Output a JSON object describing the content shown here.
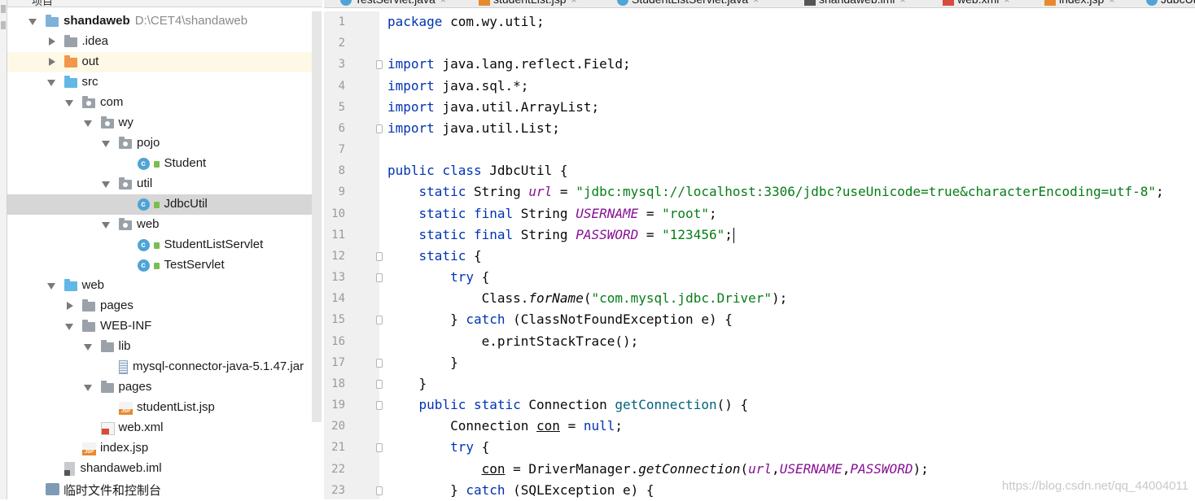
{
  "project_panel": {
    "header_label": "项目",
    "tree": [
      {
        "label": "shandaweb",
        "path": "D:\\CET4\\shandaweb",
        "icon": "project-folder-icon",
        "expanded": true
      },
      {
        "label": ".idea",
        "icon": "folder-icon",
        "expanded": false
      },
      {
        "label": "out",
        "icon": "excluded-folder-icon",
        "expanded": false
      },
      {
        "label": "src",
        "icon": "source-folder-icon",
        "expanded": true
      },
      {
        "label": "com",
        "icon": "package-icon",
        "expanded": true
      },
      {
        "label": "wy",
        "icon": "package-icon",
        "expanded": true
      },
      {
        "label": "pojo",
        "icon": "package-icon",
        "expanded": true
      },
      {
        "label": "Student",
        "icon": "class-icon"
      },
      {
        "label": "util",
        "icon": "package-icon",
        "expanded": true
      },
      {
        "label": "JdbcUtil",
        "icon": "class-icon",
        "selected": true
      },
      {
        "label": "web",
        "icon": "package-icon",
        "expanded": true
      },
      {
        "label": "StudentListServlet",
        "icon": "class-icon"
      },
      {
        "label": "TestServlet",
        "icon": "class-icon"
      },
      {
        "label": "web",
        "icon": "web-folder-icon",
        "expanded": true
      },
      {
        "label": "pages",
        "icon": "folder-icon",
        "expanded": false
      },
      {
        "label": "WEB-INF",
        "icon": "folder-icon",
        "expanded": true
      },
      {
        "label": "lib",
        "icon": "folder-icon",
        "expanded": true
      },
      {
        "label": "mysql-connector-java-5.1.47.jar",
        "icon": "jar-file-icon"
      },
      {
        "label": "pages",
        "icon": "folder-icon",
        "expanded": true
      },
      {
        "label": "studentList.jsp",
        "icon": "jsp-file-icon"
      },
      {
        "label": "web.xml",
        "icon": "xml-file-icon"
      },
      {
        "label": "index.jsp",
        "icon": "jsp-file-icon"
      },
      {
        "label": "shandaweb.iml",
        "icon": "iml-file-icon"
      },
      {
        "label": "临时文件和控制台",
        "icon": "scratches-icon"
      }
    ]
  },
  "tabs": [
    {
      "label": "TestServlet.java",
      "icon": "class-icon"
    },
    {
      "label": "studentList.jsp",
      "icon": "jsp-file-icon"
    },
    {
      "label": "StudentListServlet.java",
      "icon": "class-icon"
    },
    {
      "label": "shandaweb.iml",
      "icon": "iml-file-icon"
    },
    {
      "label": "web.xml",
      "icon": "xml-file-icon"
    },
    {
      "label": "index.jsp",
      "icon": "jsp-file-icon"
    },
    {
      "label": "JdbcUtil.java",
      "icon": "class-icon",
      "active": true
    }
  ],
  "editor": {
    "current_line": 11,
    "lines": [
      {
        "n": "1",
        "t": [
          {
            "k": "kw",
            "s": "package"
          },
          {
            "k": "",
            "s": " com.wy.util;"
          }
        ]
      },
      {
        "n": "2",
        "t": []
      },
      {
        "n": "3",
        "t": [
          {
            "k": "kw",
            "s": "import"
          },
          {
            "k": "",
            "s": " java.lang.reflect.Field;"
          }
        ]
      },
      {
        "n": "4",
        "t": [
          {
            "k": "kw",
            "s": "import"
          },
          {
            "k": "",
            "s": " java.sql.*;"
          }
        ]
      },
      {
        "n": "5",
        "t": [
          {
            "k": "kw",
            "s": "import"
          },
          {
            "k": "",
            "s": " java.util.ArrayList;"
          }
        ]
      },
      {
        "n": "6",
        "t": [
          {
            "k": "kw",
            "s": "import"
          },
          {
            "k": "",
            "s": " java.util.List;"
          }
        ]
      },
      {
        "n": "7",
        "t": []
      },
      {
        "n": "8",
        "t": [
          {
            "k": "kw",
            "s": "public class"
          },
          {
            "k": "",
            "s": " JdbcUtil {"
          }
        ]
      },
      {
        "n": "9",
        "t": [
          {
            "k": "",
            "s": "    "
          },
          {
            "k": "kw",
            "s": "static"
          },
          {
            "k": "",
            "s": " String "
          },
          {
            "k": "fld",
            "s": "url"
          },
          {
            "k": "",
            "s": " = "
          },
          {
            "k": "str",
            "s": "\"jdbc:mysql://localhost:3306/jdbc?useUnicode=true&characterEncoding=utf-8\""
          },
          {
            "k": "",
            "s": ";"
          }
        ]
      },
      {
        "n": "10",
        "t": [
          {
            "k": "",
            "s": "    "
          },
          {
            "k": "kw",
            "s": "static final"
          },
          {
            "k": "",
            "s": " String "
          },
          {
            "k": "fld",
            "s": "USERNAME"
          },
          {
            "k": "",
            "s": " = "
          },
          {
            "k": "str",
            "s": "\"root\""
          },
          {
            "k": "",
            "s": ";"
          }
        ]
      },
      {
        "n": "11",
        "t": [
          {
            "k": "",
            "s": "    "
          },
          {
            "k": "kw",
            "s": "static final"
          },
          {
            "k": "",
            "s": " String "
          },
          {
            "k": "fld",
            "s": "PASSWORD"
          },
          {
            "k": "",
            "s": " = "
          },
          {
            "k": "str",
            "s": "\"123456\""
          },
          {
            "k": "",
            "s": ";"
          }
        ]
      },
      {
        "n": "12",
        "t": [
          {
            "k": "",
            "s": "    "
          },
          {
            "k": "kw",
            "s": "static"
          },
          {
            "k": "",
            "s": " {"
          }
        ]
      },
      {
        "n": "13",
        "t": [
          {
            "k": "",
            "s": "        "
          },
          {
            "k": "kw",
            "s": "try"
          },
          {
            "k": "",
            "s": " {"
          }
        ]
      },
      {
        "n": "14",
        "t": [
          {
            "k": "",
            "s": "            Class."
          },
          {
            "k": "itl",
            "s": "forName"
          },
          {
            "k": "",
            "s": "("
          },
          {
            "k": "str",
            "s": "\"com.mysql.jdbc.Driver\""
          },
          {
            "k": "",
            "s": ");"
          }
        ]
      },
      {
        "n": "15",
        "t": [
          {
            "k": "",
            "s": "        } "
          },
          {
            "k": "kw",
            "s": "catch"
          },
          {
            "k": "",
            "s": " (ClassNotFoundException e) {"
          }
        ]
      },
      {
        "n": "16",
        "t": [
          {
            "k": "",
            "s": "            e.printStackTrace();"
          }
        ]
      },
      {
        "n": "17",
        "t": [
          {
            "k": "",
            "s": "        }"
          }
        ]
      },
      {
        "n": "18",
        "t": [
          {
            "k": "",
            "s": "    }"
          }
        ]
      },
      {
        "n": "19",
        "t": [
          {
            "k": "",
            "s": "    "
          },
          {
            "k": "kw",
            "s": "public static"
          },
          {
            "k": "",
            "s": " Connection "
          },
          {
            "k": "met",
            "s": "getConnection"
          },
          {
            "k": "",
            "s": "() {"
          }
        ]
      },
      {
        "n": "20",
        "t": [
          {
            "k": "",
            "s": "        Connection "
          },
          {
            "k": "und",
            "s": "con"
          },
          {
            "k": "",
            "s": " = "
          },
          {
            "k": "kw",
            "s": "null"
          },
          {
            "k": "",
            "s": ";"
          }
        ]
      },
      {
        "n": "21",
        "t": [
          {
            "k": "",
            "s": "        "
          },
          {
            "k": "kw",
            "s": "try"
          },
          {
            "k": "",
            "s": " {"
          }
        ]
      },
      {
        "n": "22",
        "t": [
          {
            "k": "",
            "s": "            "
          },
          {
            "k": "und",
            "s": "con"
          },
          {
            "k": "",
            "s": " = DriverManager."
          },
          {
            "k": "itl",
            "s": "getConnection"
          },
          {
            "k": "",
            "s": "("
          },
          {
            "k": "fld",
            "s": "url"
          },
          {
            "k": "",
            "s": ","
          },
          {
            "k": "fld",
            "s": "USERNAME"
          },
          {
            "k": "",
            "s": ","
          },
          {
            "k": "fld",
            "s": "PASSWORD"
          },
          {
            "k": "",
            "s": ");"
          }
        ]
      },
      {
        "n": "23",
        "t": [
          {
            "k": "",
            "s": "        } "
          },
          {
            "k": "kw",
            "s": "catch"
          },
          {
            "k": "",
            "s": " (SQLException e) {"
          }
        ]
      }
    ]
  },
  "watermark": "https://blog.csdn.net/qq_44004011",
  "colors": {
    "keyword": "#0033b3",
    "string": "#067d17",
    "field": "#871094",
    "selection": "#d6d6d6",
    "current_line": "#fcfae2"
  }
}
